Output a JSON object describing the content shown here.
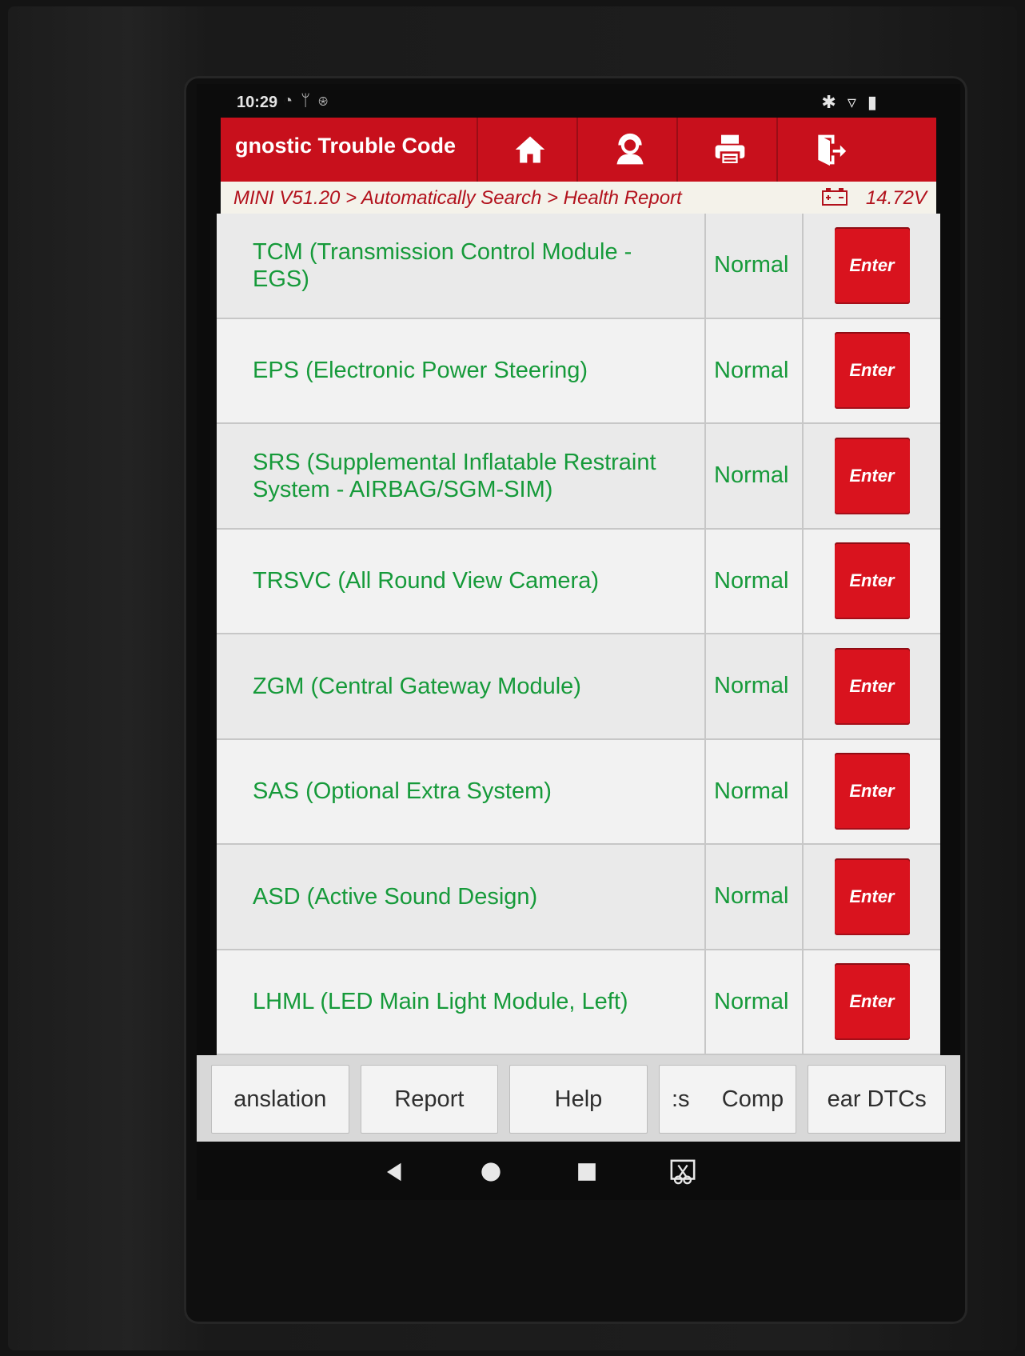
{
  "status_bar": {
    "time": "10:29"
  },
  "header": {
    "title": "gnostic Trouble Code",
    "buttons": [
      "home-icon",
      "support-icon",
      "print-icon",
      "exit-icon"
    ]
  },
  "breadcrumb": {
    "path": "MINI V51.20 > Automatically Search > Health Report",
    "voltage": "14.72V"
  },
  "modules": [
    {
      "name": "TCM (Transmission Control Module - EGS)",
      "status": "Normal",
      "action": "Enter"
    },
    {
      "name": "EPS (Electronic Power Steering)",
      "status": "Normal",
      "action": "Enter"
    },
    {
      "name": "SRS (Supplemental Inflatable Restraint System - AIRBAG/SGM-SIM)",
      "status": "Normal",
      "action": "Enter"
    },
    {
      "name": "TRSVC (All Round View Camera)",
      "status": "Normal",
      "action": "Enter"
    },
    {
      "name": "ZGM (Central Gateway Module)",
      "status": "Normal",
      "action": "Enter"
    },
    {
      "name": "SAS (Optional Extra System)",
      "status": "Normal",
      "action": "Enter"
    },
    {
      "name": "ASD (Active Sound Design)",
      "status": "Normal",
      "action": "Enter"
    },
    {
      "name": "LHML (LED Main Light Module, Left)",
      "status": "Normal",
      "action": "Enter"
    }
  ],
  "toolbar": {
    "buttons": [
      "anslation",
      "Report",
      "Help",
      ":s     Comp",
      "ear DTCs"
    ]
  },
  "colors": {
    "brand_red": "#c8101c",
    "status_green": "#169a3a",
    "enter_red": "#d9131e"
  }
}
